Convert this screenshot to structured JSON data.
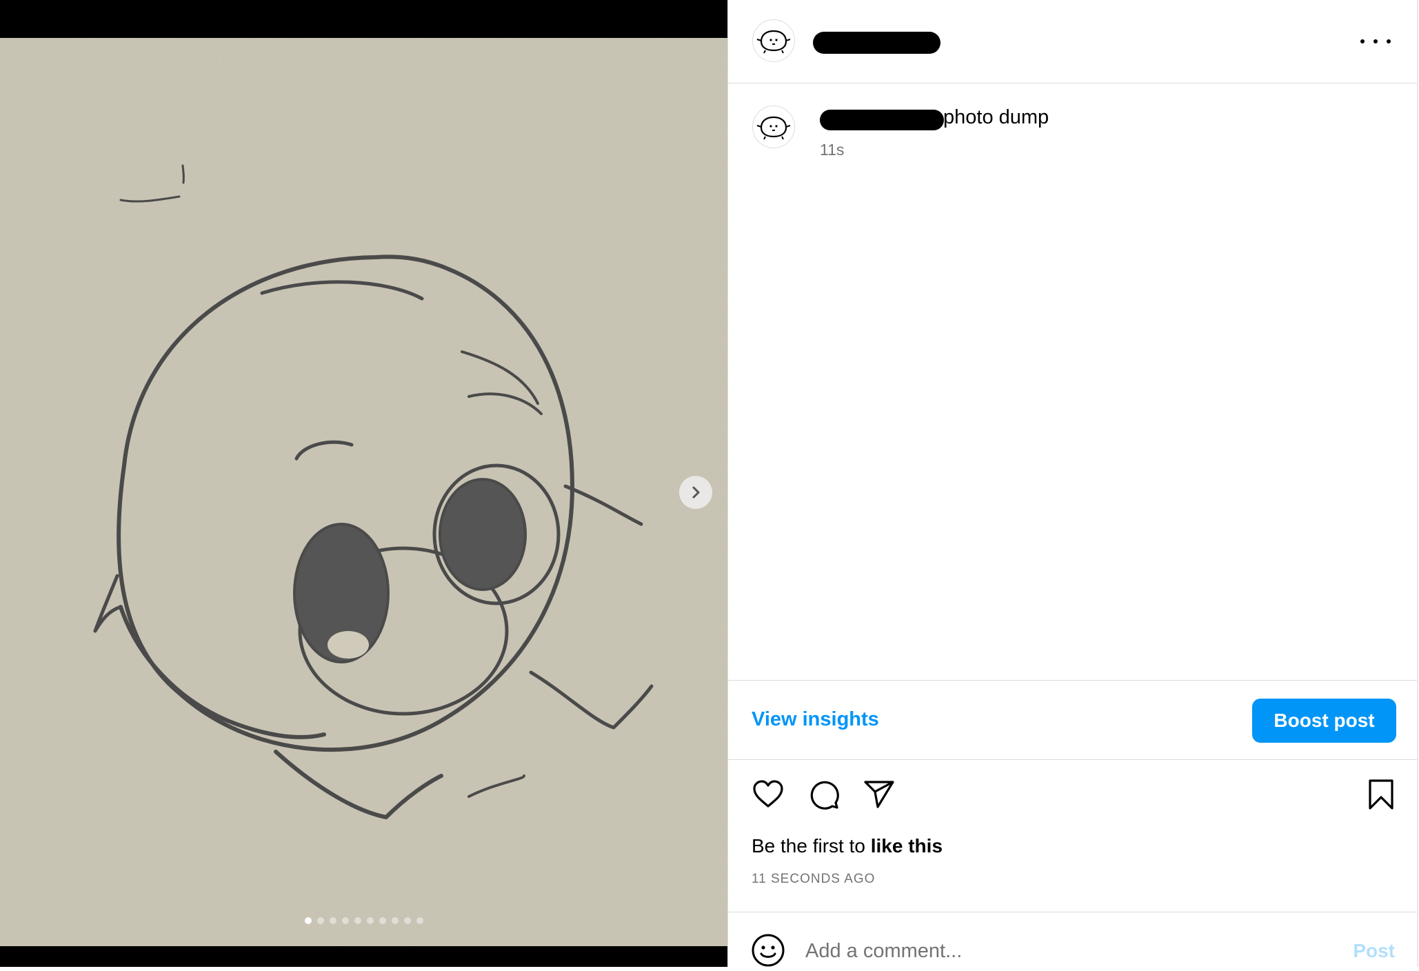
{
  "post": {
    "caption": "photo dump",
    "caption_time": "11s",
    "more_icon": "more-horizontal-icon"
  },
  "carousel": {
    "next_icon": "chevron-right-icon",
    "slide_count": 10,
    "active_slide": 1
  },
  "insights": {
    "view_insights": "View insights",
    "boost_post": "Boost post"
  },
  "actions": {
    "like_icon": "heart-icon",
    "comment_icon": "comment-icon",
    "share_icon": "send-icon",
    "save_icon": "bookmark-icon"
  },
  "likes": {
    "prefix": "Be the first to",
    "bold": "like this"
  },
  "timestamp": "11 SECONDS AGO",
  "comment": {
    "placeholder": "Add a comment...",
    "post_label": "Post",
    "emoji_icon": "emoji-icon"
  },
  "colors": {
    "accent": "#0095f6",
    "post_disabled": "#b2dffc",
    "secondary_text": "#737373",
    "paper": "#cdc8b8",
    "pencil": "#4a4a4a"
  }
}
